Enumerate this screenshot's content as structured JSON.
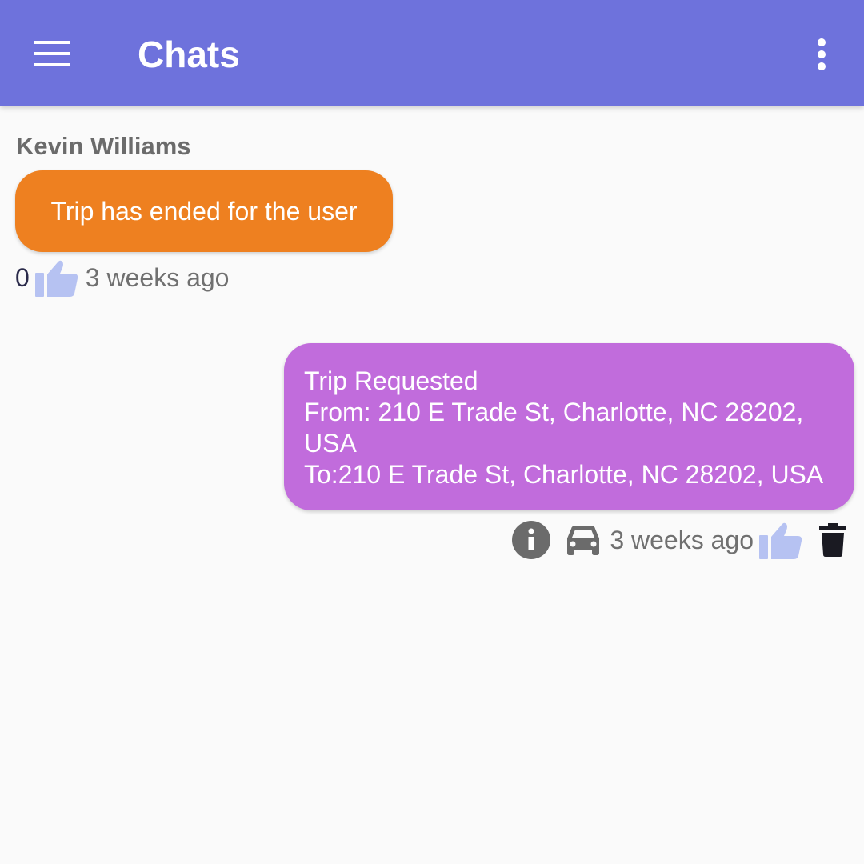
{
  "header": {
    "title": "Chats",
    "menu_icon": "hamburger-menu-icon",
    "overflow_icon": "more-vert-icon",
    "color": "#6e72dc"
  },
  "messages": [
    {
      "direction": "incoming",
      "sender": "Kevin Williams",
      "text": "Trip has ended for the user",
      "like_count": "0",
      "timestamp": "3 weeks ago",
      "bubble_color": "#ee8020"
    },
    {
      "direction": "outgoing",
      "lines": [
        "Trip Requested",
        "From: 210 E Trade St, Charlotte, NC 28202,",
        "USA",
        "To:210 E Trade St, Charlotte, NC 28202, USA"
      ],
      "timestamp": "3 weeks ago",
      "icons": [
        "info-icon",
        "car-icon",
        "thumbs-up-icon",
        "trash-icon"
      ],
      "bubble_color": "#c16cdc"
    }
  ]
}
